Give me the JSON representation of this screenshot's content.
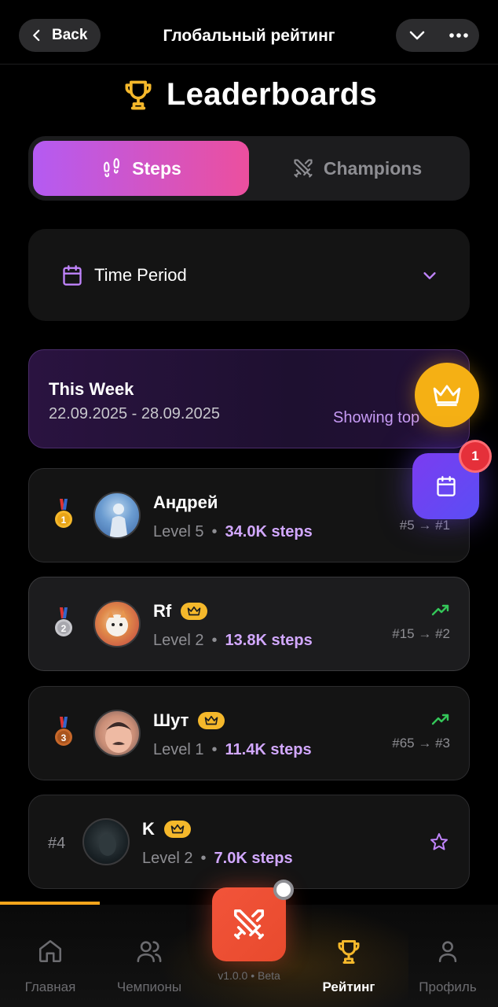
{
  "topbar": {
    "back_label": "Back",
    "title": "Глобальный рейтинг"
  },
  "heading": {
    "title": "Leaderboards",
    "icon": "trophy-icon",
    "icon_color": "#f5b82b"
  },
  "tabs": [
    {
      "label": "Steps",
      "icon": "footsteps-icon",
      "active": true
    },
    {
      "label": "Champions",
      "icon": "crossed-swords-icon",
      "active": false
    }
  ],
  "period": {
    "label": "Time Period",
    "icon": "calendar-icon"
  },
  "week": {
    "title": "This Week",
    "dates": "22.09.2025 - 28.09.2025",
    "showing": "Showing top"
  },
  "leaders": [
    {
      "rank": "1",
      "name": "Андрей",
      "level": "Level 5",
      "steps": "34.0K steps",
      "change": "#5 → #1",
      "crown": false,
      "trend": false
    },
    {
      "rank": "2",
      "name": "Rf",
      "level": "Level 2",
      "steps": "13.8K steps",
      "change": "#15 → #2",
      "crown": true,
      "trend": true
    },
    {
      "rank": "3",
      "name": "Шут",
      "level": "Level 1",
      "steps": "11.4K steps",
      "change": "#65 → #3",
      "crown": true,
      "trend": true
    },
    {
      "rank": "#4",
      "name": "K",
      "level": "Level 2",
      "steps": "7.0K steps",
      "change": "",
      "crown": true,
      "trend": false
    }
  ],
  "separator": "•",
  "notification_count": "1",
  "nav": [
    {
      "label": "Главная",
      "icon": "home-icon",
      "active": false
    },
    {
      "label": "Чемпионы",
      "icon": "users-icon",
      "active": false
    },
    {
      "label": "Рейтинг",
      "icon": "trophy-icon",
      "active": true
    },
    {
      "label": "Профиль",
      "icon": "profile-icon",
      "active": false
    }
  ],
  "version": "v1.0.0 • Beta",
  "colors": {
    "accent_purple": "#d2a8ff",
    "accent_gold": "#f5b82b",
    "trend_green": "#34c759",
    "center_button": "#f2543a"
  }
}
